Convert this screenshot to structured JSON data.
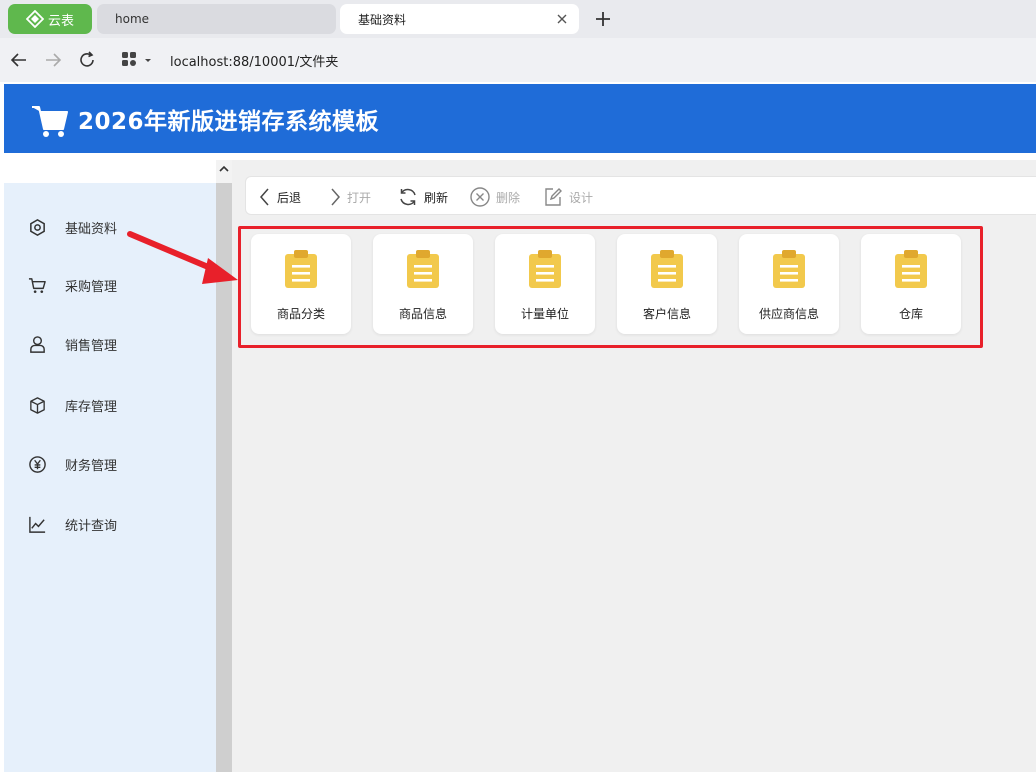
{
  "browser": {
    "brand_label": "云表",
    "tabs": [
      {
        "label": "home"
      },
      {
        "label": "基础资料"
      }
    ],
    "url": "localhost:88/10001/文件夹"
  },
  "app": {
    "title": "2026年新版进销存系统模板",
    "header_color": "#1f6cd8"
  },
  "sidebar": {
    "items": [
      {
        "label": "基础资料",
        "icon": "hexagon-icon"
      },
      {
        "label": "采购管理",
        "icon": "cart-icon"
      },
      {
        "label": "销售管理",
        "icon": "person-icon"
      },
      {
        "label": "库存管理",
        "icon": "box-icon"
      },
      {
        "label": "财务管理",
        "icon": "yen-icon"
      },
      {
        "label": "统计查询",
        "icon": "chart-icon"
      }
    ]
  },
  "toolbar": {
    "back": "后退",
    "open": "打开",
    "refresh": "刷新",
    "delete": "删除",
    "design": "设计"
  },
  "cards": [
    {
      "label": "商品分类",
      "icon": "clipboard-icon"
    },
    {
      "label": "商品信息",
      "icon": "clipboard-icon"
    },
    {
      "label": "计量单位",
      "icon": "clipboard-icon"
    },
    {
      "label": "客户信息",
      "icon": "clipboard-icon"
    },
    {
      "label": "供应商信息",
      "icon": "clipboard-icon"
    },
    {
      "label": "仓库",
      "icon": "clipboard-icon"
    }
  ],
  "annotation_color": "#e8202a",
  "card_icon_color": "#f2c94c"
}
